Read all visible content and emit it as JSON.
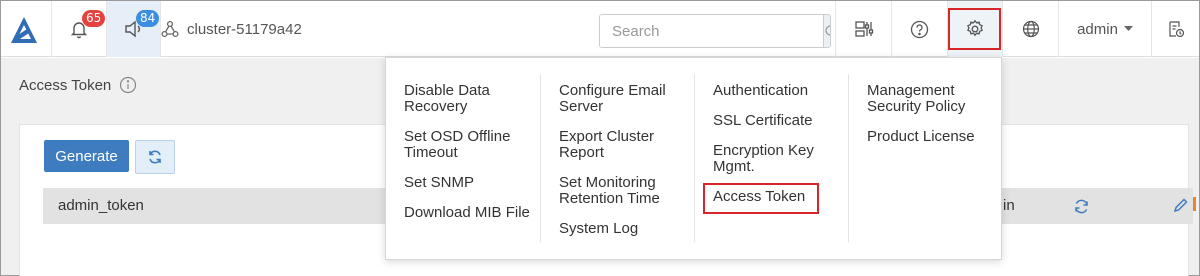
{
  "header": {
    "alerts_badge": "65",
    "notifications_badge": "84",
    "cluster_name": "cluster-51179a42",
    "search_placeholder": "Search",
    "user_name": "admin"
  },
  "page": {
    "title": "Access Token"
  },
  "toolbar": {
    "generate_label": "Generate"
  },
  "table": {
    "rows": [
      {
        "name": "admin_token",
        "tail": "in"
      }
    ]
  },
  "settings_menu": {
    "columns": [
      [
        "Disable Data Recovery",
        "Set OSD Offline Timeout",
        "Set SNMP",
        "Download MIB File"
      ],
      [
        "Configure Email Server",
        "Export Cluster Report",
        "Set Monitoring Retention Time",
        "System Log"
      ],
      [
        "Authentication",
        "SSL Certificate",
        "Encryption Key Mgmt.",
        "Access Token"
      ],
      [
        "Management Security Policy",
        "Product License"
      ]
    ],
    "selected_item": "Access Token"
  },
  "colors": {
    "accent": "#3f7cbf",
    "badge_red": "#e5423f",
    "badge_blue": "#3c8fe0",
    "highlight": "#d9252a"
  }
}
